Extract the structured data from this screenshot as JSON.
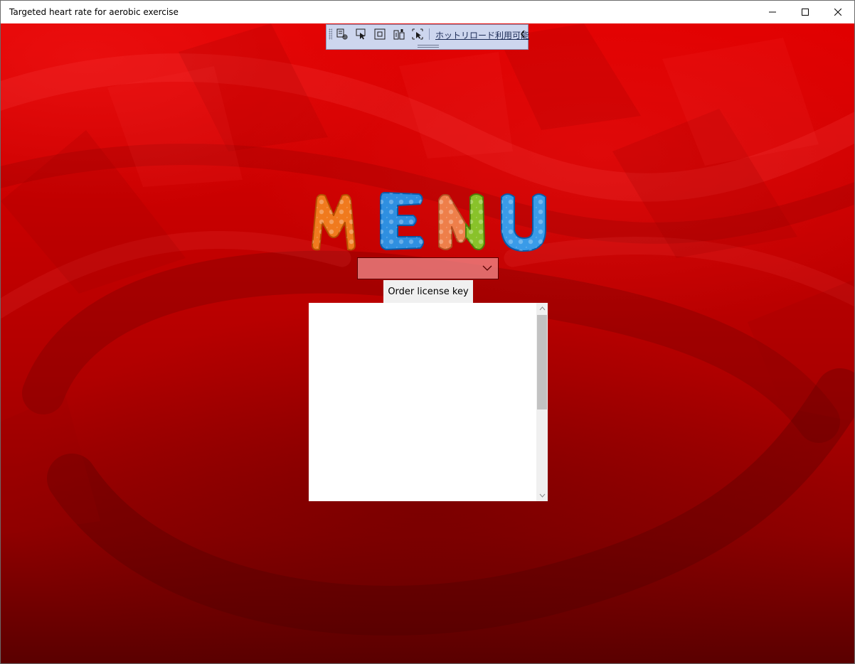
{
  "window": {
    "title": "Targeted heart rate for aerobic exercise"
  },
  "debug_toolbar": {
    "hot_reload_label": "ホットリロード利用可能",
    "icons": [
      "live-visual-tree-icon",
      "select-element-icon",
      "display-layout-adorners-icon",
      "track-focus-icon",
      "binding-failures-icon"
    ]
  },
  "menu": {
    "title_image_label": "MENU",
    "letter_colors": [
      "#f07a1e",
      "#2f8fe0",
      "#ee7f4a",
      "#89c22a",
      "#3a9be8"
    ]
  },
  "dropdown": {
    "selected_value": ""
  },
  "order_button": {
    "label": "Order license key"
  },
  "list": {
    "items": []
  },
  "colors": {
    "background_top": "#e10000",
    "background_bottom": "#5a0000",
    "toolbar_bg": "#cdd6ee",
    "dropdown_bg": "#f28c8c"
  }
}
